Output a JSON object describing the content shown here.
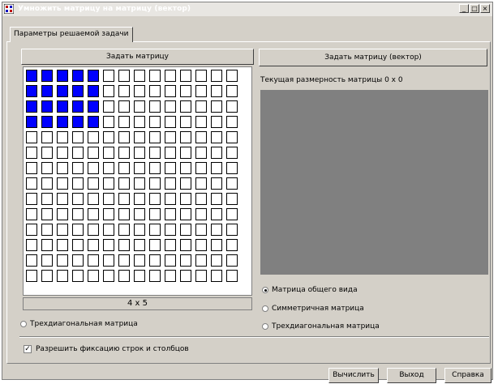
{
  "window": {
    "title": "Умножить матрицу на матрицу (вектор)",
    "min_glyph": "_",
    "max_glyph": "□",
    "close_glyph": "×"
  },
  "tabs": [
    {
      "label": "Параметры решаемой задачи"
    }
  ],
  "left": {
    "set_matrix_label": "Задать матрицу",
    "size_label": "4 x 5",
    "grid": {
      "rows": 14,
      "cols": 14,
      "selected_rows": 4,
      "selected_cols": 5,
      "selected_color": "#0000ff"
    },
    "tridiagonal_label": "Трехдиагональная матрица"
  },
  "right": {
    "set_matrix_vector_label": "Задать матрицу (вектор)",
    "dimension_text": "Текущая размерность матрицы 0 x 0",
    "matrix_types": [
      {
        "label": "Матрица общего вида",
        "checked": true
      },
      {
        "label": "Симметричная матрица",
        "checked": false
      },
      {
        "label": "Трехдиагональная матрица",
        "checked": false
      }
    ]
  },
  "allow_fix_label": "Разрешить фиксацию строк и столбцов",
  "allow_fix_checked": true,
  "footer": {
    "compute_label": "Вычислить",
    "exit_label": "Выход",
    "help_label": "Справка"
  }
}
